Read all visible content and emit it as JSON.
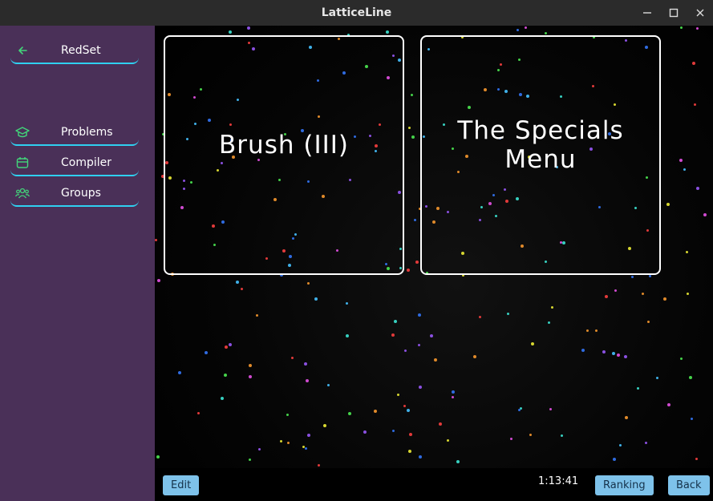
{
  "window": {
    "title": "LatticeLine",
    "minimize": "—",
    "maximize": "☐",
    "close": "✕"
  },
  "sidebar": {
    "back": {
      "label": "RedSet",
      "icon": "arrow-left-icon"
    },
    "items": [
      {
        "label": "Problems",
        "icon": "graduation-cap-icon"
      },
      {
        "label": "Compiler",
        "icon": "calendar-icon"
      },
      {
        "label": "Groups",
        "icon": "users-icon"
      }
    ],
    "accent": "#2fd0f0",
    "background": "#4a3058"
  },
  "cards": [
    {
      "title": "Brush (III)"
    },
    {
      "title": "The Specials\nMenu"
    }
  ],
  "bottom": {
    "edit_label": "Edit",
    "timer": "1:13:41",
    "ranking_label": "Ranking",
    "back_label": "Back"
  }
}
